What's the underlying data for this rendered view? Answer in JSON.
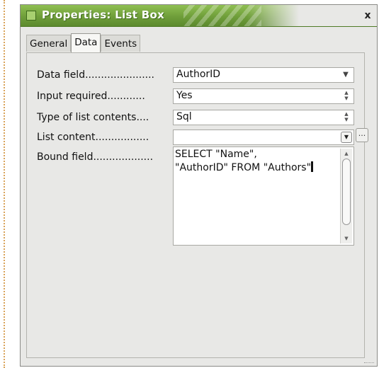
{
  "window": {
    "title": "Properties: List Box",
    "close_label": "x"
  },
  "tabs": [
    {
      "label": "General",
      "active": false
    },
    {
      "label": "Data",
      "active": true
    },
    {
      "label": "Events",
      "active": false
    }
  ],
  "fields": {
    "data_field": {
      "label": "Data field......................",
      "value": "AuthorID"
    },
    "input_required": {
      "label": "Input required............",
      "value": "Yes"
    },
    "list_contents_type": {
      "label": "Type of list contents....",
      "value": "Sql"
    },
    "list_content": {
      "label": "List content.................",
      "value": ""
    },
    "bound_field": {
      "label": "Bound field...................",
      "value": "SELECT \"Name\",\n\"AuthorID\" FROM \"Authors\""
    }
  },
  "buttons": {
    "ellipsis_label": "..."
  },
  "icons": {
    "title_icon": "window-icon",
    "close": "close-icon",
    "dropdown": "chevron-down-icon",
    "spin": "spin-arrows-icon"
  },
  "colors": {
    "titlebar": "#6f9e3a",
    "window_bg": "#e8e8e6"
  }
}
